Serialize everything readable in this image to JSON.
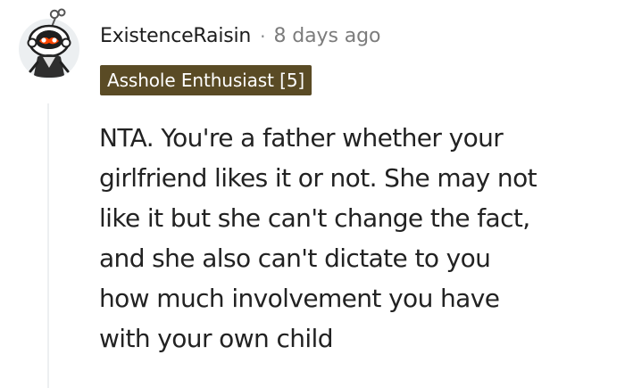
{
  "comment": {
    "username": "ExistenceRaisin",
    "separator": "·",
    "timestamp": "8 days ago",
    "flair": "Asshole Enthusiast [5]",
    "body_lines": [
      "NTA. You're a father whether your",
      "girlfriend likes it or not. She may not",
      "like it but she can't change the fact,",
      "and she also can't dictate to you",
      "how much involvement you have",
      "with your own child"
    ]
  },
  "colors": {
    "flair_background": "#5a4b25",
    "flair_text": "#ffffff",
    "username": "#1c1c1c",
    "timestamp": "#7c7c7c",
    "body_text": "#222222",
    "thread_line": "#edeff1",
    "avatar_accent": "#ff4500"
  },
  "icons": {
    "avatar": "snoo-avatar-icon"
  }
}
